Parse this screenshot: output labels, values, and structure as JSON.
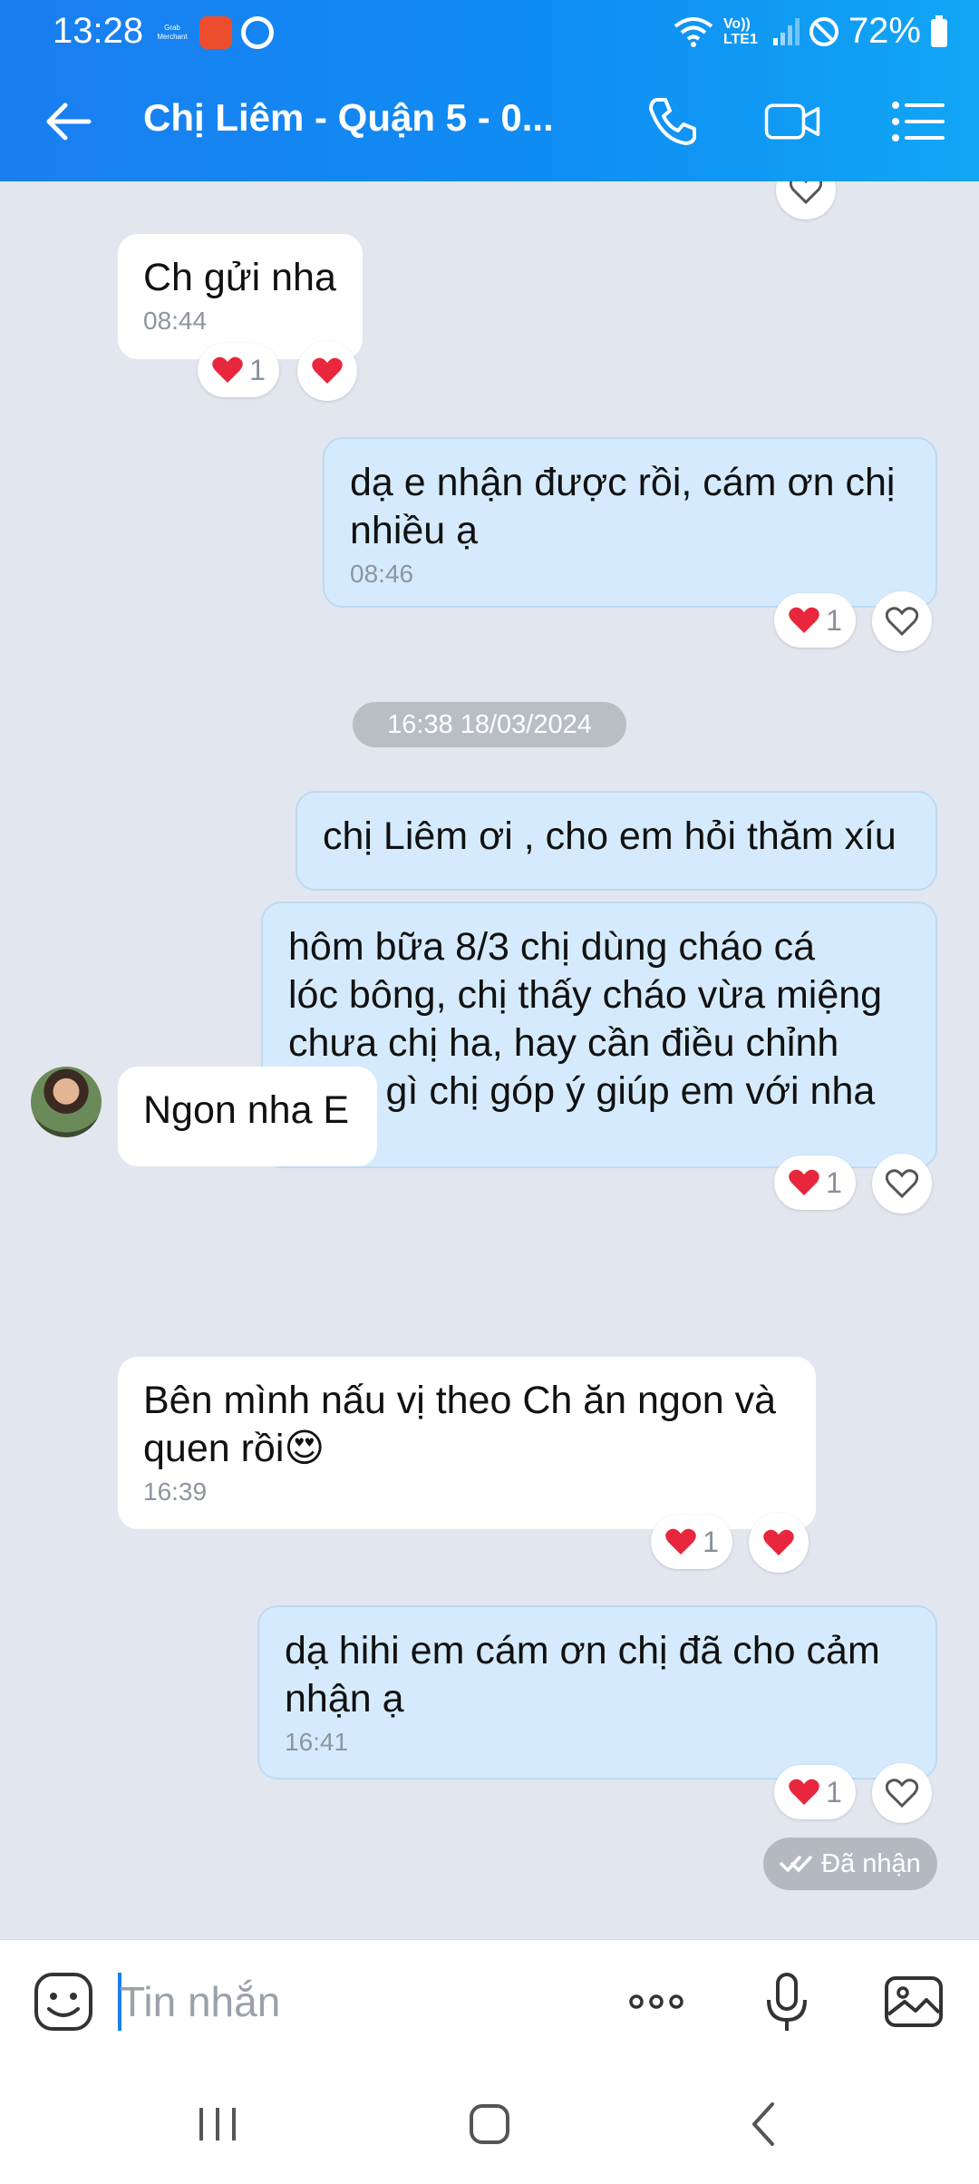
{
  "status_bar": {
    "time": "13:28",
    "app_badges": [
      "Grab Merchant",
      "Shopee Partner",
      "Zalo"
    ],
    "network": "Vo)) LTE1",
    "battery": "72%"
  },
  "header": {
    "title": "Chị Liêm - Quận 5 - 0...",
    "icons": [
      "back-arrow-icon",
      "phone-icon",
      "video-call-icon",
      "menu-list-icon"
    ]
  },
  "messages": [
    {
      "dir": "in",
      "text": "Ch gửi nha",
      "time": "08:44",
      "reaction_count": "1"
    },
    {
      "dir": "out",
      "text": "dạ e nhận được rồi, cám ơn chị\nnhiều ạ",
      "time": "08:46",
      "reaction_count": "1"
    },
    {
      "dir": "out",
      "text": "chị Liêm ơi , cho em hỏi thăm xíu",
      "time": "",
      "reaction_count": ""
    },
    {
      "dir": "out",
      "text": "hôm bữa 8/3 chị dùng cháo cá\nlóc bông, chị thấy cháo vừa miệng\nchưa chị ha, hay cần điều chỉnh\nthêm gì chị góp ý giúp em với nha",
      "time": "16:38",
      "reaction_count": "1"
    },
    {
      "dir": "in",
      "text": "Ngon nha E",
      "time": "",
      "reaction_count": ""
    },
    {
      "dir": "in",
      "text": "Bên mình nấu vị theo Ch ăn ngon và\nquen rồi😍",
      "time": "16:39",
      "reaction_count": "1"
    },
    {
      "dir": "out",
      "text": "dạ hihi em cám ơn chị đã cho cảm\nnhận ạ",
      "time": "16:41",
      "reaction_count": "1"
    }
  ],
  "date_separator": "16:38 18/03/2024",
  "delivery_status": "Đã nhận",
  "input": {
    "placeholder": "Tin nhắn",
    "icons": [
      "sticker-icon",
      "more-icon",
      "microphone-icon",
      "image-icon"
    ]
  },
  "nav": {
    "icons": [
      "recent-apps-icon",
      "home-icon",
      "back-icon"
    ]
  },
  "colors": {
    "header_start": "#1a7ef0",
    "header_end": "#11a6f5",
    "chat_bg": "#e2e6ee",
    "outgoing_bubble": "#d5ebfd",
    "incoming_bubble": "#ffffff",
    "heart": "#e8263d"
  }
}
